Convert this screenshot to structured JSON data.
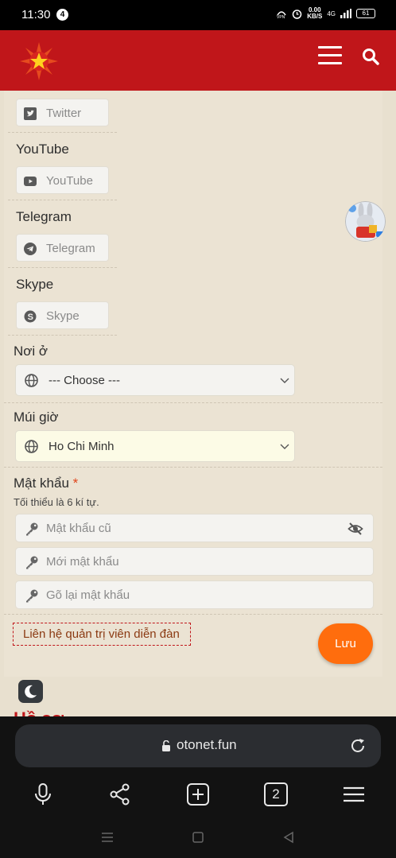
{
  "status_bar": {
    "time": "11:30",
    "notification_count": "4",
    "net_speed_top": "0.00",
    "net_speed_unit": "KB/S",
    "network": "4G",
    "battery": "61"
  },
  "header": {
    "logo": "star-logo",
    "menu_icon": "hamburger-icon",
    "search_icon": "search-icon",
    "brand_color": "#c0161a"
  },
  "social": {
    "twitter": {
      "placeholder": "Twitter"
    },
    "youtube": {
      "label": "YouTube",
      "placeholder": "YouTube"
    },
    "telegram": {
      "label": "Telegram",
      "placeholder": "Telegram"
    },
    "skype": {
      "label": "Skype",
      "placeholder": "Skype"
    }
  },
  "location": {
    "label": "Nơi ở",
    "value": "--- Choose ---"
  },
  "timezone": {
    "label": "Múi giờ",
    "value": "Ho Chi Minh"
  },
  "password": {
    "label": "Mật khẩu",
    "required_mark": "*",
    "hint": "Tối thiểu là 6 kí tự.",
    "old_placeholder": "Mật khẩu cũ",
    "new_placeholder": "Mới mật khẩu",
    "confirm_placeholder": "Gõ lại mật khẩu"
  },
  "actions": {
    "contact_admin": "Liên hệ quản trị viên diễn đàn",
    "save": "Lưu",
    "save_color": "#ff6d0d"
  },
  "peek": {
    "text": "Hồ sơ"
  },
  "browser": {
    "url": "otonet.fun",
    "tab_count": "2"
  }
}
